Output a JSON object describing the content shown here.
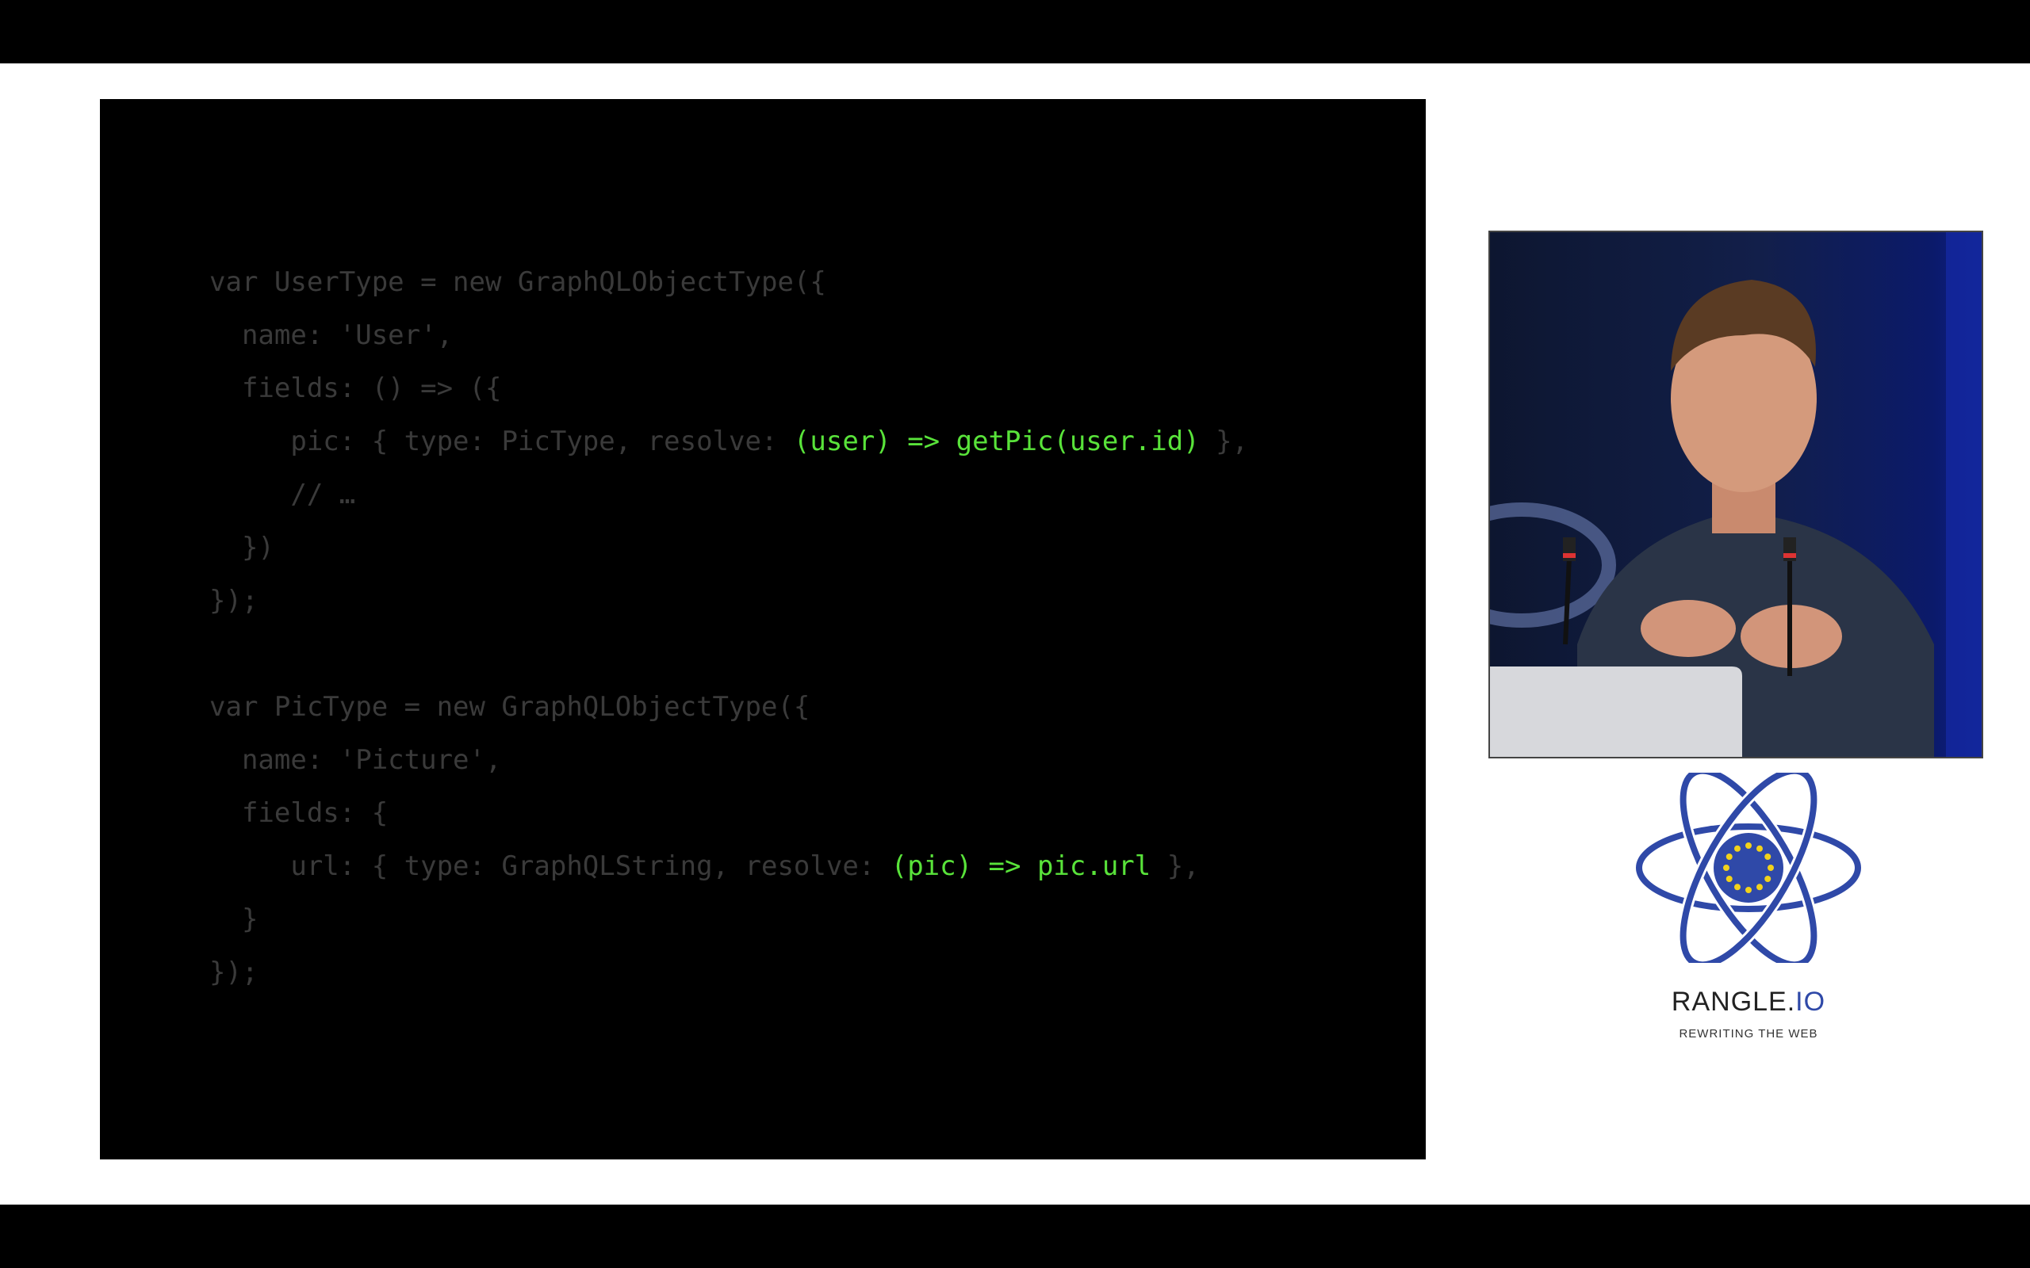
{
  "slide": {
    "code_lines": [
      [
        {
          "t": "var UserType = new GraphQLObjectType({",
          "h": false
        }
      ],
      [
        {
          "t": "  name: 'User',",
          "h": false
        }
      ],
      [
        {
          "t": "  fields: () => ({",
          "h": false
        }
      ],
      [
        {
          "t": "     pic: { type: PicType, resolve: ",
          "h": false
        },
        {
          "t": "(user) => getPic(user.id)",
          "h": true
        },
        {
          "t": " },",
          "h": false
        }
      ],
      [
        {
          "t": "     // …",
          "h": false
        }
      ],
      [
        {
          "t": "  })",
          "h": false
        }
      ],
      [
        {
          "t": "});",
          "h": false
        }
      ],
      [
        {
          "t": "",
          "h": false
        }
      ],
      [
        {
          "t": "var PicType = new GraphQLObjectType({",
          "h": false
        }
      ],
      [
        {
          "t": "  name: 'Picture',",
          "h": false
        }
      ],
      [
        {
          "t": "  fields: {",
          "h": false
        }
      ],
      [
        {
          "t": "     url: { type: GraphQLString, resolve: ",
          "h": false
        },
        {
          "t": "(pic) => pic.url",
          "h": true
        },
        {
          "t": " },",
          "h": false
        }
      ],
      [
        {
          "t": "  }",
          "h": false
        }
      ],
      [
        {
          "t": "});",
          "h": false
        }
      ]
    ]
  },
  "branding": {
    "name_main": "RANGLE.",
    "name_accent": "IO",
    "tagline": "REWRITING THE WEB"
  },
  "colors": {
    "code_dim": "#3a3a3a",
    "code_highlight": "#59e33a",
    "logo_blue": "#2f49a8",
    "eu_star": "#f2d21b"
  },
  "icons": {
    "logo": "react-atom-eu-stars-icon"
  }
}
